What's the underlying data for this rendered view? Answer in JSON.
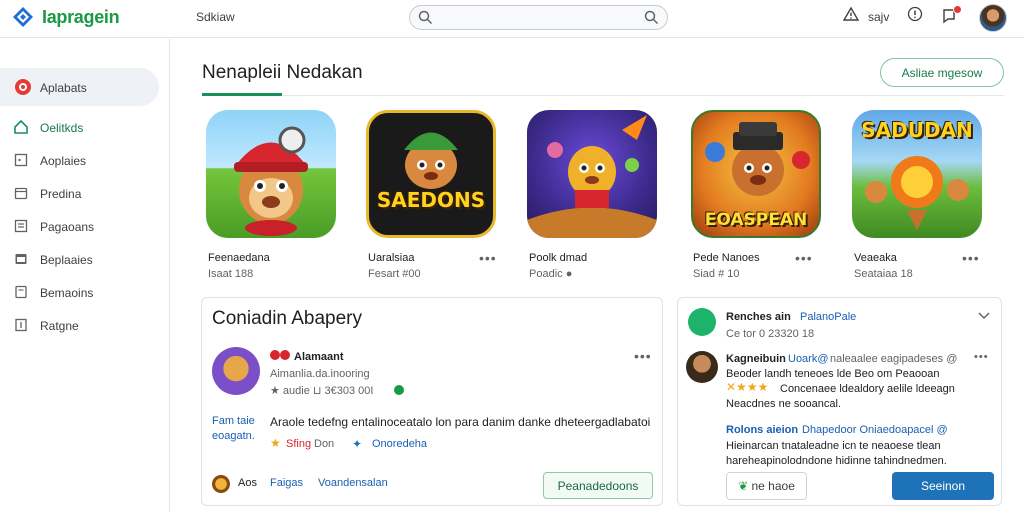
{
  "header": {
    "logo_text": "Iapragein",
    "nav_label": "Sdkiaw",
    "search_placeholder": "",
    "right_label": "sajv",
    "notification_badge": "3"
  },
  "sidebar": {
    "items": [
      {
        "label": "Aplabats",
        "icon": "app-logo-icon"
      },
      {
        "label": "Oelitkds",
        "icon": "home-icon"
      },
      {
        "label": "Aoplaies",
        "icon": "square-icon"
      },
      {
        "label": "Predina",
        "icon": "box-icon"
      },
      {
        "label": "Pagaoans",
        "icon": "list-icon"
      },
      {
        "label": "Beplaaies",
        "icon": "folder-icon"
      },
      {
        "label": "Bemaoins",
        "icon": "document-icon"
      },
      {
        "label": "Ratgne",
        "icon": "bookmark-icon"
      }
    ]
  },
  "main": {
    "title": "Nenapleii Nedakan",
    "see_all": "Asliae mgesow"
  },
  "apps": [
    {
      "name": "Feenaedana",
      "meta": "Isaat 188",
      "tile_text": ""
    },
    {
      "name": "Uaralsiaa",
      "meta": "Fesart #00",
      "tile_text": "SAEDONS"
    },
    {
      "name": "Poolk dmad",
      "meta": "Poadic ●",
      "tile_text": ""
    },
    {
      "name": "Pede Nanoes",
      "meta": "Siad # 10",
      "tile_text": "EOASPEAN"
    },
    {
      "name": "Veaeaka",
      "meta": "Seataiaa 18",
      "tile_text": "SADUDAN"
    }
  ],
  "company": {
    "title": "Coniadin Abapery",
    "app_name": "Alamaant",
    "app_sub": "Aimanlia.da.inooring",
    "app_meta": "★ audie ⊔ 3€303 00I",
    "side_label_1": "Fam taie",
    "side_label_2": "eoagatn.",
    "description": "Araole tedefng entalinoceatalo lon para danim danke dheteergadlabatoi",
    "tag_1": "Sfing",
    "tag_1b": "Don",
    "tag_2": "Onoredeha",
    "footer_1": "Aos",
    "footer_2": "Faigas",
    "footer_3": "Voandensalan",
    "button": "Peanadedoons"
  },
  "reviews": {
    "header_title": "Renches ain",
    "header_title_2": "PalanoPale",
    "header_meta": "Ce tor 0 23320 18",
    "r1_name": "Kagneibuin",
    "r1_handle": "Uoark@",
    "r1_line1": "naleaalee eagipadeses @",
    "r1_line2": "Beoder landh teneoes lde Beo  om Peaooan",
    "r1_line3": "Concenaee ldealdory aelile ldeeagn",
    "r1_line4": "Neacdnes ne sooancal.",
    "r2_name": "Rolons aieion",
    "r2_handle": "Dhapedoor Oniaedoapacel @",
    "r2_line1": "Hieinarcan tnataleadne icn te neaoese tlean",
    "r2_line2": "hareheapinolodndone hidinne tahindnedmen.",
    "btn_left": "ne haoe",
    "btn_right": "Seeinon"
  },
  "colors": {
    "brand_green": "#1a9a44",
    "accent_blue": "#1e72b8",
    "badge_red": "#e53935"
  }
}
